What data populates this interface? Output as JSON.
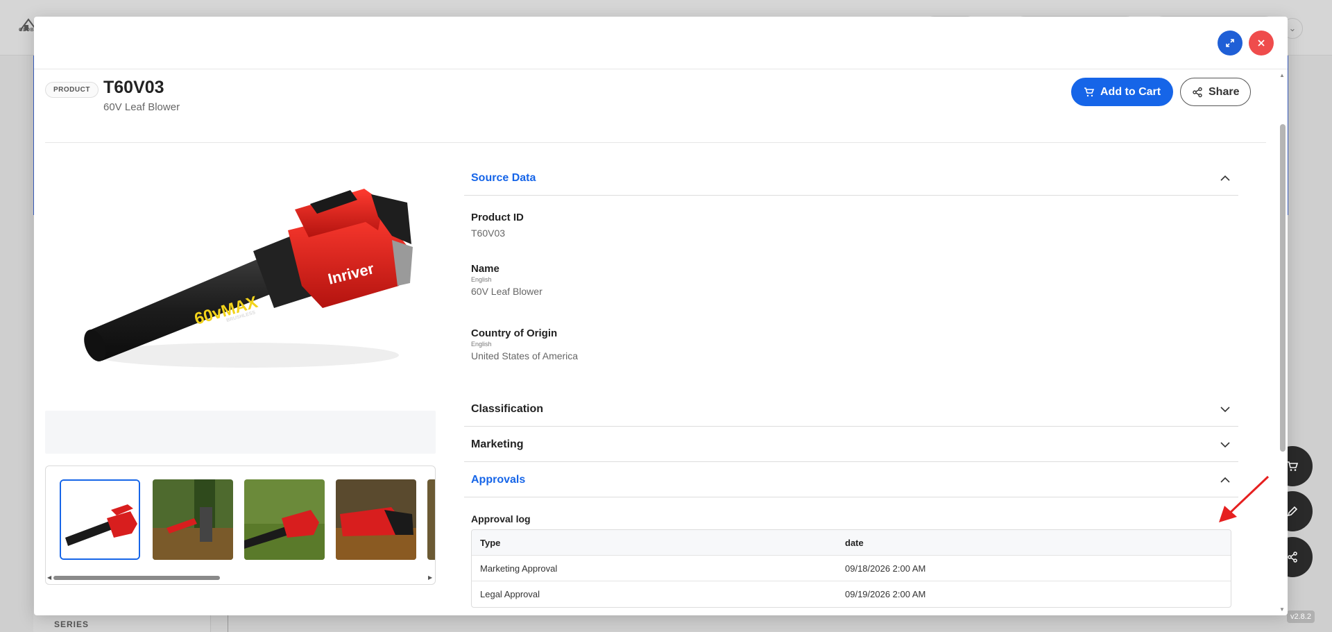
{
  "background": {
    "logo_text": "GLOBAL",
    "sidebar_section": "SERIES",
    "version": "v2.8.2"
  },
  "modal": {
    "badge": "PRODUCT",
    "title": "T60V03",
    "subtitle": "60V Leaf Blower",
    "add_to_cart_label": "Add to Cart",
    "share_label": "Share"
  },
  "sections": {
    "source_data": {
      "label": "Source Data",
      "fields": {
        "product_id": {
          "label": "Product ID",
          "value": "T60V03"
        },
        "name": {
          "label": "Name",
          "lang": "English",
          "value": "60V Leaf Blower"
        },
        "country": {
          "label": "Country of Origin",
          "lang": "English",
          "value": "United States of America"
        }
      }
    },
    "classification": {
      "label": "Classification"
    },
    "marketing": {
      "label": "Marketing"
    },
    "approvals": {
      "label": "Approvals",
      "log_title": "Approval log",
      "columns": [
        "Type",
        "date"
      ],
      "rows": [
        [
          "Marketing Approval",
          "09/18/2026 2:00 AM"
        ],
        [
          "Legal Approval",
          "09/19/2026 2:00 AM"
        ]
      ]
    }
  },
  "product_image": {
    "brand_text": "Inriver",
    "model_text": "60vMAX",
    "model_sub": "BRUSHLESS"
  },
  "colors": {
    "accent": "#1665e8",
    "close": "#ef4c4c",
    "product_red": "#d81e1e"
  }
}
